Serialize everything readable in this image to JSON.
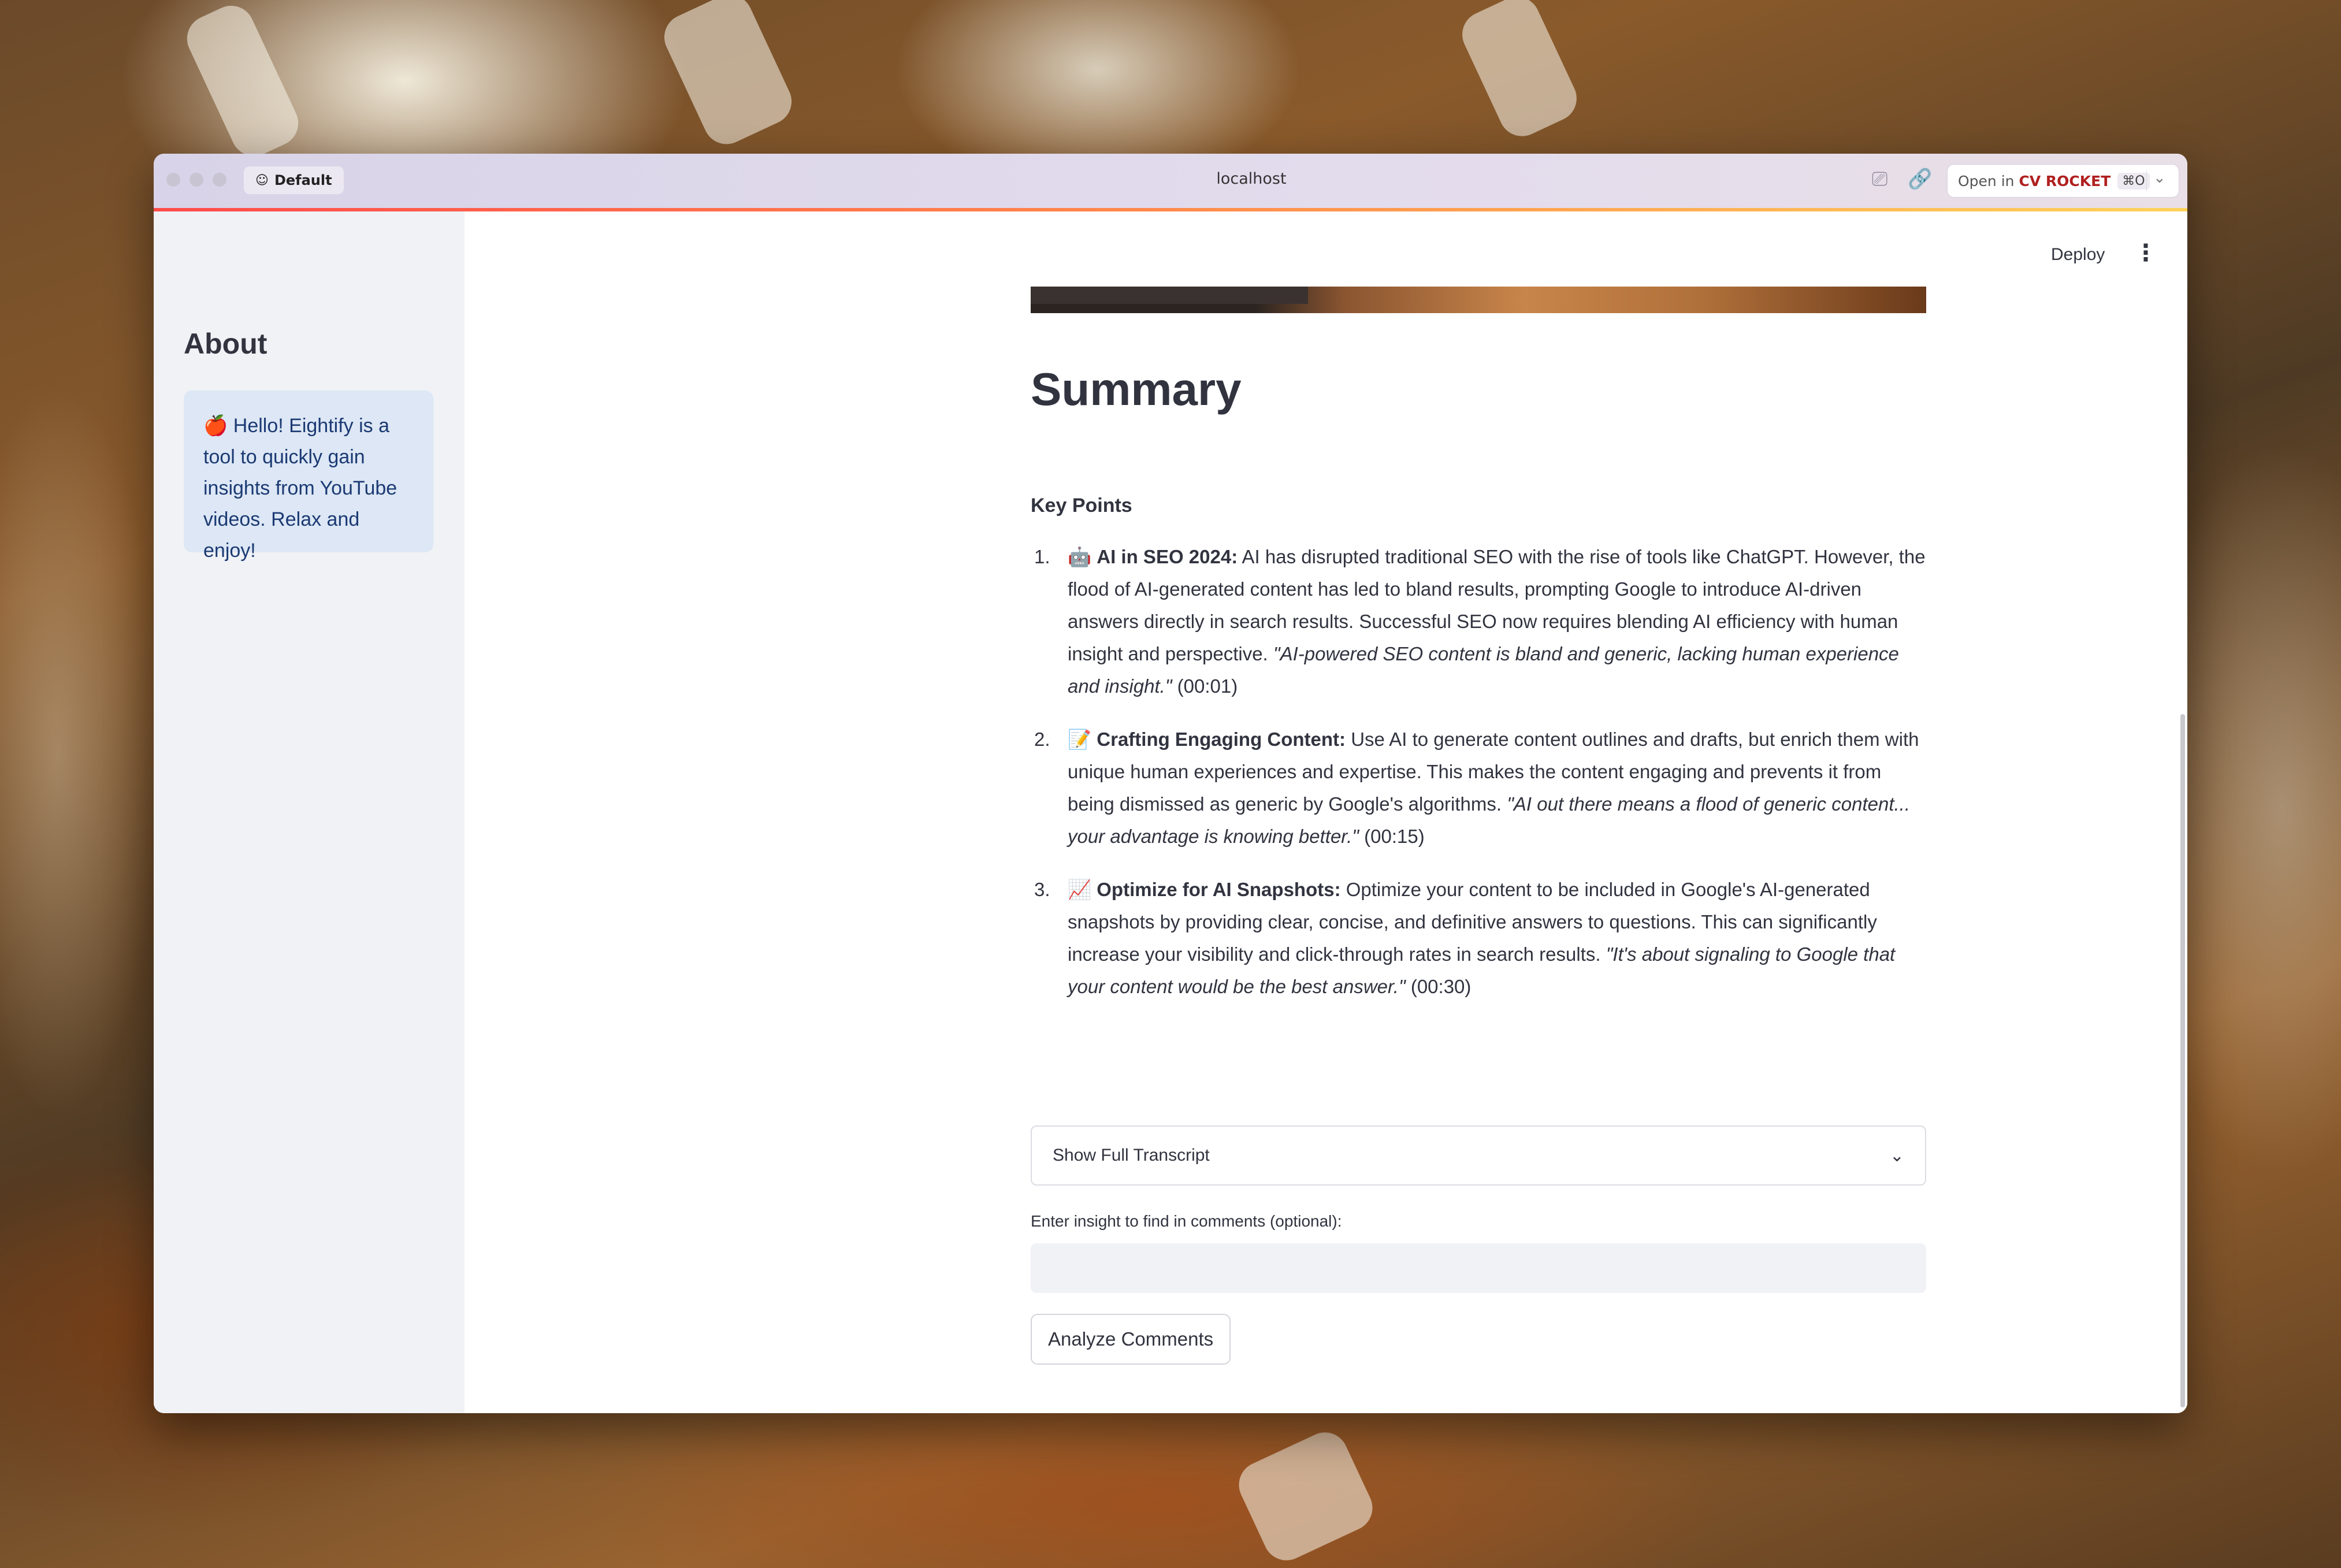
{
  "browser": {
    "profile_label": "Default",
    "url": "localhost",
    "open_in_prefix": "Open in",
    "open_in_brand": "CV ROCKET",
    "open_in_shortcut": "⌘O"
  },
  "header": {
    "deploy_label": "Deploy"
  },
  "sidebar": {
    "title": "About",
    "info_text": "🍎 Hello! Eightify is a tool to quickly gain insights from YouTube videos. Relax and enjoy!"
  },
  "main": {
    "summary_title": "Summary",
    "key_points_label": "Key Points",
    "key_points": [
      {
        "number": "1.",
        "emoji": "🤖",
        "heading": "AI in SEO 2024:",
        "text": " AI has disrupted traditional SEO with the rise of tools like ChatGPT. However, the flood of AI-generated content has led to bland results, prompting Google to introduce AI-driven answers directly in search results. Successful SEO now requires blending AI efficiency with human insight and perspective. ",
        "quote": "\"AI-powered SEO content is bland and generic, lacking human experience and insight.\"",
        "timestamp": " (00:01)"
      },
      {
        "number": "2.",
        "emoji": "📝",
        "heading": "Crafting Engaging Content:",
        "text": " Use AI to generate content outlines and drafts, but enrich them with unique human experiences and expertise. This makes the content engaging and prevents it from being dismissed as generic by Google's algorithms. ",
        "quote": "\"AI out there means a flood of generic content... your advantage is knowing better.\"",
        "timestamp": " (00:15)"
      },
      {
        "number": "3.",
        "emoji": "📈",
        "heading": "Optimize for AI Snapshots:",
        "text": " Optimize your content to be included in Google's AI-generated snapshots by providing clear, concise, and definitive answers to questions. This can significantly increase your visibility and click-through rates in search results. ",
        "quote": "\"It's about signaling to Google that your content would be the best answer.\"",
        "timestamp": " (00:30)"
      }
    ],
    "transcript_expander_label": "Show Full Transcript",
    "comments_input_label": "Enter insight to find in comments (optional):",
    "comments_input_value": "",
    "analyze_button_label": "Analyze Comments"
  },
  "icons": {
    "kebab": "more-vertical-icon",
    "expander": "chevron-down-icon"
  },
  "colors": {
    "accent": "#ff4b4b",
    "sidebar_bg": "#f0f2f6",
    "info_bg": "#dde7f5",
    "info_text": "#1b3a73",
    "text": "#31333f"
  }
}
